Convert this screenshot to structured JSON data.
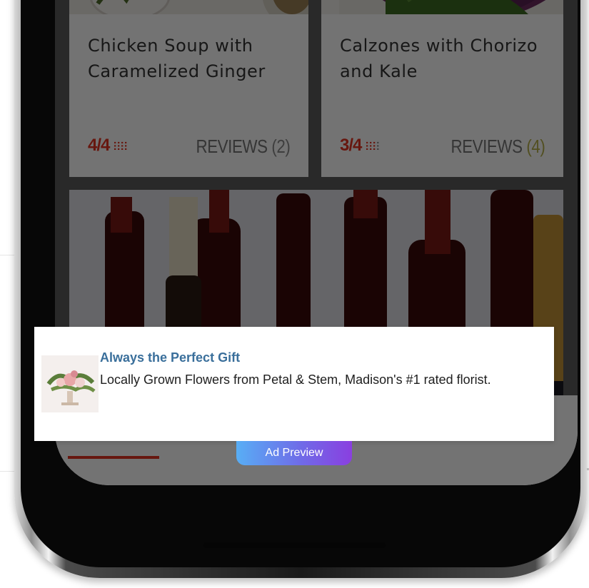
{
  "recipes": [
    {
      "title": "Chicken Soup with Caramelized Ginger",
      "rating": "4/4",
      "reviews_label": "REVIEWS",
      "reviews_count": "(2)"
    },
    {
      "title": "Calzones with Chorizo and Kale",
      "rating": "3/4",
      "reviews_label": "REVIEWS",
      "reviews_count": "(4)"
    }
  ],
  "ad": {
    "title": "Always the Perfect Gift",
    "body": "Locally Grown Flowers from Petal & Stem, Madison's #1 rated florist.",
    "badge": "Ad Preview"
  },
  "tabbar": {
    "items": [
      {
        "icon": "home-icon",
        "active": true
      },
      {
        "icon": "timer-icon",
        "active": false
      },
      {
        "icon": "search-icon",
        "active": false
      },
      {
        "icon": "list-icon",
        "active": false
      },
      {
        "icon": "pot-icon",
        "active": false
      }
    ]
  },
  "colors": {
    "accent": "#e53322",
    "ad_title": "#3a6f9b",
    "badge_gradient_start": "#58aef5",
    "badge_gradient_end": "#8a3fe0"
  }
}
